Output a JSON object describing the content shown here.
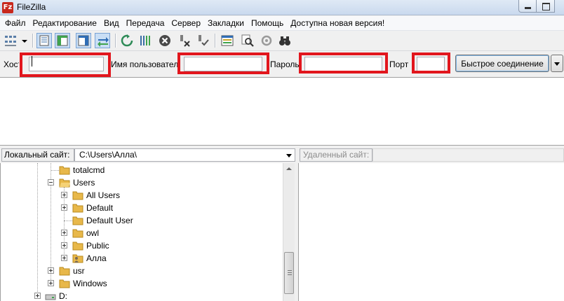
{
  "window": {
    "title": "FileZilla",
    "logo_text": "Fz"
  },
  "menu": [
    "Файл",
    "Редактирование",
    "Вид",
    "Передача",
    "Сервер",
    "Закладки",
    "Помощь",
    "Доступна новая версия!"
  ],
  "toolbar": {
    "icons": [
      "site-manager-icon",
      "toggle-message-log-icon",
      "toggle-local-tree-icon",
      "toggle-remote-tree-icon",
      "toggle-transfer-queue-icon",
      "refresh-icon",
      "process-queue-icon",
      "cancel-icon",
      "disconnect-icon",
      "reconnect-icon",
      "directory-filters-icon",
      "search-files-icon",
      "compare-directories-icon",
      "find-binoculars-icon"
    ]
  },
  "quickconnect": {
    "host_label": "Хост",
    "user_label": "Имя пользователя",
    "password_label": "Пароль",
    "port_label": "Порт",
    "host_value": "",
    "user_value": "",
    "password_value": "",
    "port_value": "",
    "connect_button": "Быстрое соединение",
    "highlight_color": "#e2161d"
  },
  "local": {
    "label": "Локальный сайт:",
    "path": "C:\\Users\\Алла\\",
    "tree": [
      {
        "label": "totalcmd",
        "expander": "none"
      },
      {
        "label": "Users",
        "expander": "minus"
      },
      {
        "label": "All Users",
        "expander": "plus"
      },
      {
        "label": "Default",
        "expander": "plus"
      },
      {
        "label": "Default User",
        "expander": "none"
      },
      {
        "label": "owl",
        "expander": "plus"
      },
      {
        "label": "Public",
        "expander": "plus"
      },
      {
        "label": "Алла",
        "expander": "plus"
      },
      {
        "label": "usr",
        "expander": "plus"
      },
      {
        "label": "Windows",
        "expander": "plus"
      },
      {
        "label": "D:",
        "expander": "plus"
      }
    ]
  },
  "remote": {
    "label": "Удаленный сайт:",
    "path": ""
  }
}
